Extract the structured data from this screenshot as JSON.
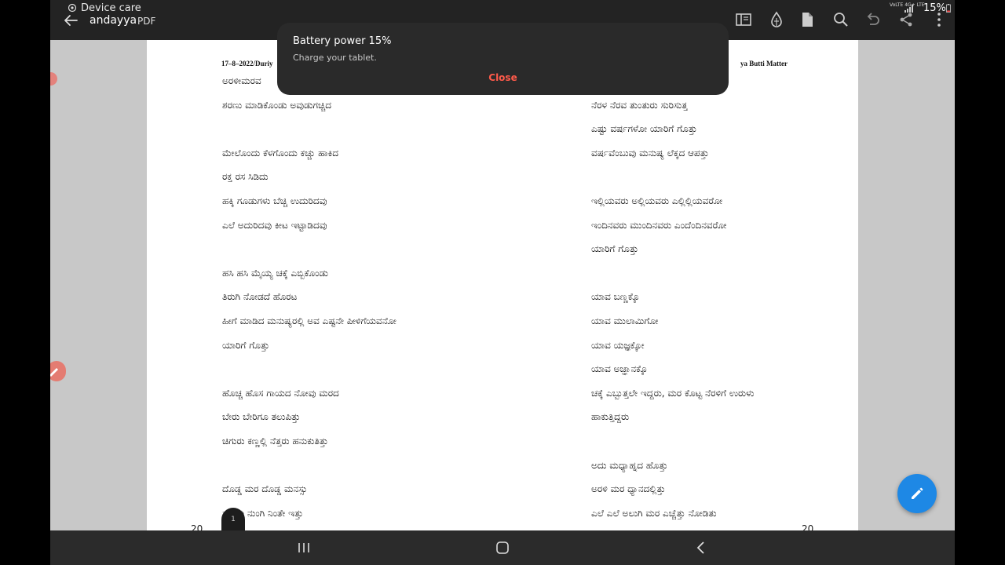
{
  "status": {
    "device_care": "Device care",
    "network": "VoLTE 4G+ LTE",
    "battery": "15%"
  },
  "toolbar": {
    "doc_title": "andayya",
    "doc_type": "PDF",
    "icons": [
      "reading-mode-icon",
      "eye-comfort-icon",
      "file-icon",
      "search-icon",
      "undo-icon",
      "share-icon",
      "more-icon"
    ]
  },
  "toast": {
    "title": "Battery power 15%",
    "subtitle": "Charge your tablet.",
    "close": "Close"
  },
  "pdf": {
    "header_left": "17–8–2022/Duriy",
    "header_right": "ya Butti Matter",
    "left_lines": [
      "ಅರಳೀಮರವ",
      "ಶರಣು ಮಾಡಿಕೊಂಡು ಅವುಡುಗಚ್ಚಿದ",
      "",
      "ಮೇಲೊಂದು ಕೆಳಗೊಂದು ಕಚ್ಚು ಹಾಕಿದ",
      "ರಕ್ತ ರಸ ಸಿಡಿದು",
      "ಹಕ್ಕಿ ಗೂಡುಗಳು ಬೆಚ್ಚಿ ಉದುರಿದವು",
      "ಎಲೆ ಅದುರಿದವು ಕೀಟ ಇಟ್ಟಾಡಿದವು",
      "",
      "ಹಸಿ ಹಸಿ ಮೈಯ್ಯ ಚಕ್ಕೆ ಎಬ್ಬಿಕೊಂಡು",
      "ತಿರುಗಿ ನೋಡದೆ ಹೊರಟ",
      "ಹೀಗೆ ಮಾಡಿದ ಮನುಷ್ಯರಲ್ಲಿ ಅವ ಎಷ್ಟನೇ ಪೀಳಿಗೆಯವನೋ",
      "ಯಾರಿಗೆ ಗೊತ್ತು",
      "",
      "ಹೊಚ್ಚ ಹೊಸ ಗಾಯದ ನೋವು ಮರದ",
      "ಬೇರು ಬೇರಿಗೂ ತಲುಪಿತ್ತು",
      "ಚಿಗುರು ಕಣ್ಣಲ್ಲಿ ನೆತ್ತರು ಹನುಕುತಿತ್ತು",
      "",
      "ದೊಡ್ಡ ಮರ ದೊಡ್ಡ ಮನಸ್ಸು",
      "ನೋವು ನುಂಗಿ ನಿಂತೇ ಇತ್ತು"
    ],
    "right_lines": [
      "",
      "ನೆರಳ ನೆರವ ತುಂತುರು ಸುರಿಸುತ್ತ",
      "ಎಷ್ಟು ವರ್ಷಗಳೋ ಯಾರಿಗೆ ಗೊತ್ತು",
      "ವರ್ಷವೆಂಬುವು ಮನುಷ್ಯ ಲೆಕ್ಕದ ಆಪತ್ತು",
      "",
      "ಇಲ್ಲಿಯವರು ಅಲ್ಲಿಯವರು ಎಲ್ಲಿಲ್ಲಿಯವರೋ",
      "ಇಂದಿನವರು ಮುಂದಿನವರು ಎಂದೆಂದಿನವರೋ",
      "ಯಾರಿಗೆ ಗೊತ್ತು",
      "",
      "ಯಾವ ಬಣ್ಣಕ್ಕೊ",
      "ಯಾವ ಮುಲಾಮಿಗೋ",
      "ಯಾವ ಯಜ್ಞಕ್ಕೋ",
      "ಯಾವ ಅಜ್ಞಾನಕ್ಕೊ",
      "ಚಕ್ಕೆ ಎಬ್ಬುತ್ತಲೇ ಇದ್ದರು, ಮರ ಕೊಟ್ಟ ನೆರಳಿಗೆ ಉರುಳು",
      "ಹಾಕುತ್ತಿದ್ದರು",
      "",
      "ಅದು ಮಧ್ಯಾಹ್ನದ ಹೊತ್ತು",
      "ಅರಳಿ ಮರ ಧ್ಯಾನದಲ್ಲಿತ್ತು",
      "ಎಲೆ ಎಲೆ ಅಲುಗಿ ಮರ ಎಚ್ಚೆತ್ತು ನೋಡಿತು"
    ],
    "page_left": "20",
    "page_right": "20",
    "scroll_page": "1"
  },
  "colors": {
    "accent_close": "#ff5a4a",
    "fab": "#1e88e5",
    "toolbar_bg": "#232323",
    "toast_bg": "#2a2a2a"
  },
  "nav": {
    "icons": [
      "recents-icon",
      "home-icon",
      "back-icon"
    ]
  }
}
